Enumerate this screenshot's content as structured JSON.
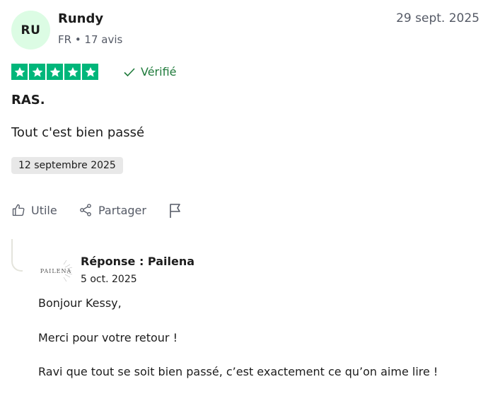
{
  "reviewer": {
    "initials": "RU",
    "name": "Rundy",
    "meta": "FR • 17 avis"
  },
  "review": {
    "date": "29 sept. 2025",
    "rating": 5,
    "verified_label": "Vérifié",
    "title": "RAS.",
    "body": "Tout c'est bien passé",
    "experience_date": "12 septembre 2025"
  },
  "actions": {
    "useful": "Utile",
    "share": "Partager"
  },
  "reply": {
    "logo_text": "PAILENA",
    "title": "Réponse : Pailena",
    "date": "5 oct. 2025",
    "lines": [
      "Bonjour Kessy,",
      "Merci pour votre retour !",
      "Ravi que tout se soit bien passé, c’est exactement ce qu’on aime lire !"
    ]
  },
  "colors": {
    "star_green": "#00b67a",
    "avatar_bg": "#dcfce4",
    "verified_green": "#1e7a3a",
    "muted_text": "#555a66"
  }
}
